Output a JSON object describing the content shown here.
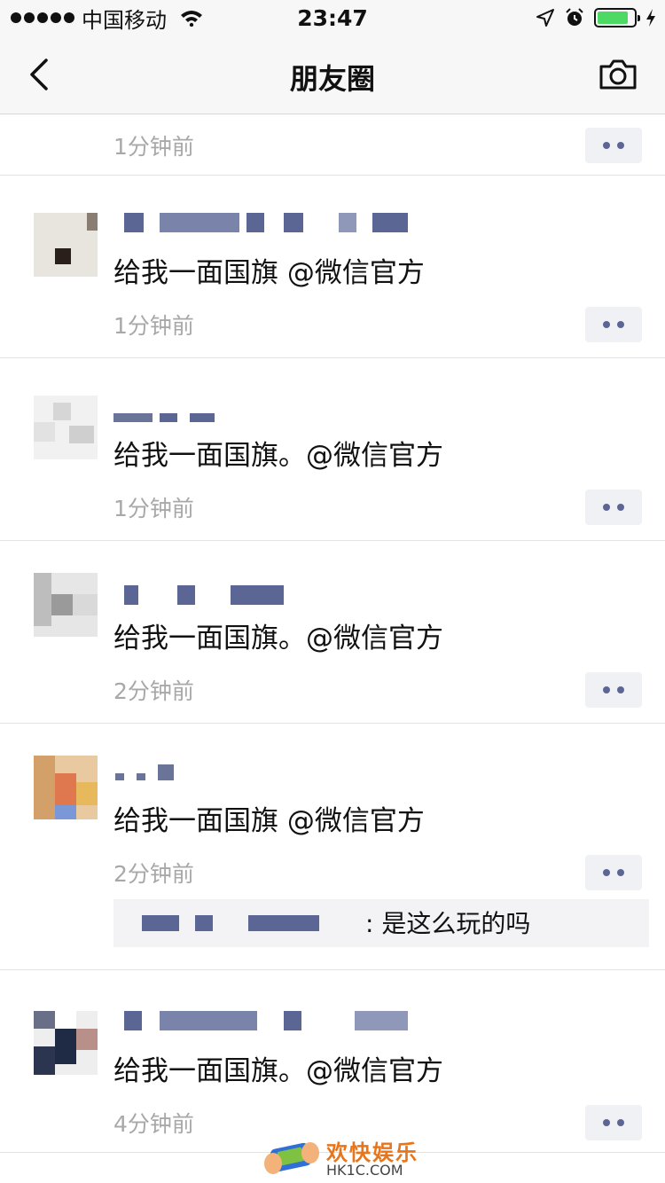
{
  "status_bar": {
    "carrier": "中国移动",
    "time": "23:47",
    "battery_level": 0.85,
    "battery_color": "#4cd964"
  },
  "nav": {
    "title": "朋友圈",
    "back_icon": "chevron-left-icon",
    "camera_icon": "camera-icon"
  },
  "posts": [
    {
      "content": "",
      "time": "1分钟前"
    },
    {
      "content": "给我一面国旗 @微信官方",
      "time": "1分钟前"
    },
    {
      "content": "给我一面国旗。@微信官方",
      "time": "1分钟前"
    },
    {
      "content": "给我一面国旗。@微信官方",
      "time": "2分钟前"
    },
    {
      "content": "给我一面国旗 @微信官方",
      "time": "2分钟前",
      "comment": "是这么玩的吗"
    },
    {
      "content": "给我一面国旗。@微信官方",
      "time": "4分钟前"
    }
  ],
  "comment_separator": ": ",
  "watermark": {
    "name": "欢快娱乐",
    "url": "HK1C.COM"
  },
  "colors": {
    "link_blue": "#5b6694",
    "time_gray": "#a8a8a8",
    "bar_bg": "#f7f7f7"
  }
}
